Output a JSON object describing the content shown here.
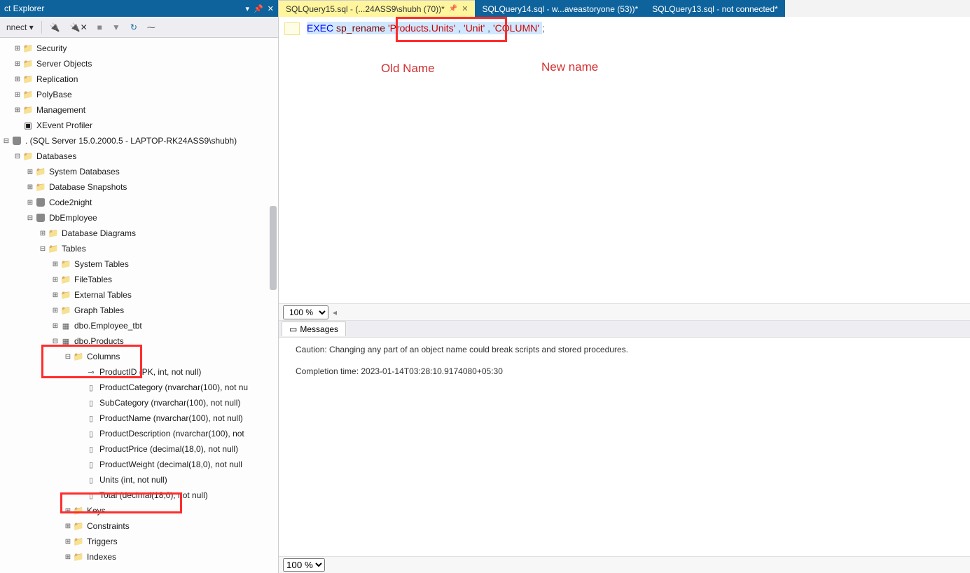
{
  "objectExplorer": {
    "title": "ct Explorer",
    "toolbar": {
      "connect": "nnect ▾"
    },
    "tree": {
      "root": [
        {
          "id": "security",
          "label": "Security"
        },
        {
          "id": "serverobjects",
          "label": "Server Objects"
        },
        {
          "id": "replication",
          "label": "Replication"
        },
        {
          "id": "polybase",
          "label": "PolyBase"
        },
        {
          "id": "management",
          "label": "Management"
        },
        {
          "id": "xevent",
          "label": "XEvent Profiler",
          "icon": "box"
        }
      ],
      "server": ". (SQL Server 15.0.2000.5 - LAPTOP-RK24ASS9\\shubh)",
      "databasesLabel": "Databases",
      "dbFolders": [
        {
          "id": "sysdb",
          "label": "System Databases"
        },
        {
          "id": "snapshots",
          "label": "Database Snapshots"
        }
      ],
      "databases": [
        {
          "id": "code2night",
          "label": "Code2night"
        }
      ],
      "currentDb": "DbEmployee",
      "dbNode": {
        "diagrams": "Database Diagrams",
        "tablesLabel": "Tables",
        "tableFolders": [
          {
            "id": "systables",
            "label": "System Tables"
          },
          {
            "id": "filetables",
            "label": "FileTables"
          },
          {
            "id": "externaltables",
            "label": "External Tables"
          },
          {
            "id": "graphtables",
            "label": "Graph Tables"
          }
        ],
        "tables": [
          {
            "id": "employee",
            "label": "dbo.Employee_tbt"
          },
          {
            "id": "products",
            "label": "dbo.Products"
          }
        ],
        "columnsLabel": "Columns",
        "columns": [
          {
            "label": "ProductID (PK, int, not null)",
            "pk": true
          },
          {
            "label": "ProductCategory (nvarchar(100), not nu"
          },
          {
            "label": "SubCategory (nvarchar(100), not null)"
          },
          {
            "label": "ProductName (nvarchar(100), not null)"
          },
          {
            "label": "ProductDescription (nvarchar(100), not"
          },
          {
            "label": "ProductPrice (decimal(18,0), not null)"
          },
          {
            "label": "ProductWeight (decimal(18,0), not null"
          },
          {
            "label": "Units (int, not null)",
            "highlight": true
          },
          {
            "label": "Total (decimal(18,0), not null)"
          }
        ],
        "tableSubFolders": [
          {
            "id": "keys",
            "label": "Keys"
          },
          {
            "id": "constraints",
            "label": "Constraints"
          },
          {
            "id": "triggers",
            "label": "Triggers"
          },
          {
            "id": "indexes",
            "label": "Indexes"
          }
        ]
      }
    }
  },
  "tabs": [
    {
      "label": "SQLQuery15.sql - (...24ASS9\\shubh (70))*",
      "active": true
    },
    {
      "label": "SQLQuery14.sql - w...aveastoryone (53))*",
      "active": false
    },
    {
      "label": "SQLQuery13.sql - not connected*",
      "active": false
    }
  ],
  "code": {
    "exec": "EXEC",
    "sp": "sp_rename",
    "arg1": "'Products.Units'",
    "arg2": "'Unit'",
    "arg3": "'COLUMN'",
    "semicolon": ";"
  },
  "annotations": {
    "oldName": "Old Name",
    "newName": "New name"
  },
  "zoom": "100 %",
  "messagesTab": "Messages",
  "messages": {
    "line1": "Caution: Changing any part of an object name could break scripts and stored procedures.",
    "line2": "Completion time: 2023-01-14T03:28:10.9174080+05:30"
  },
  "zoom2": "100 %"
}
